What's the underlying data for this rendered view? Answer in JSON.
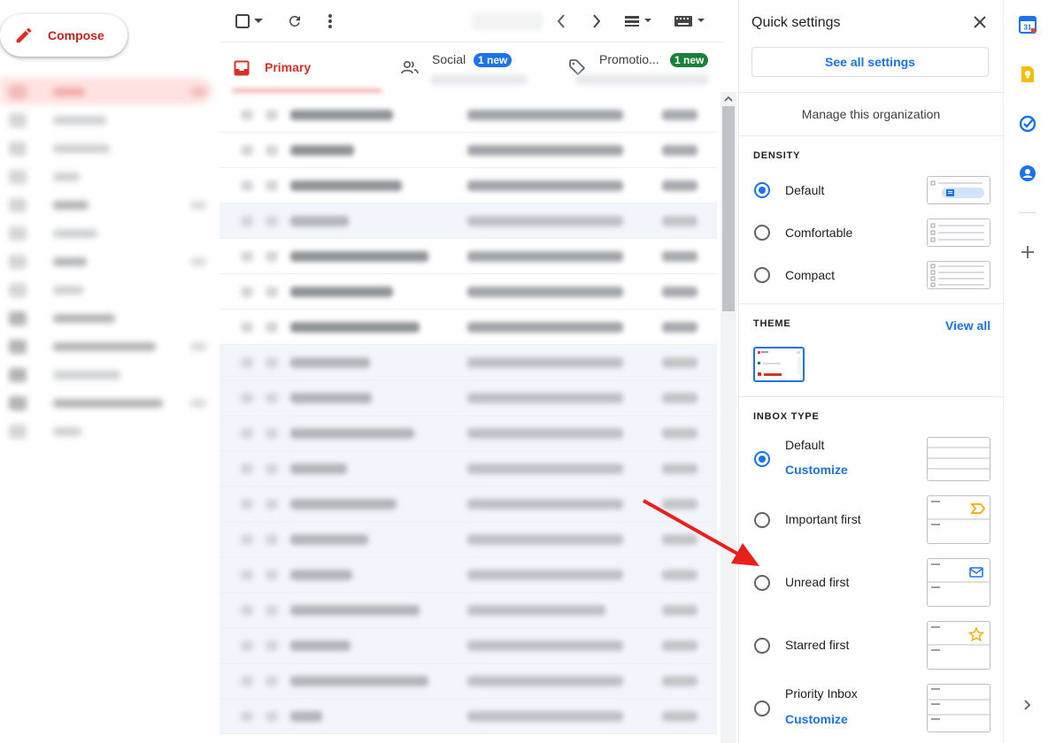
{
  "compose": {
    "label": "Compose"
  },
  "tabs": {
    "primary": "Primary",
    "social": "Social",
    "social_badge": "1 new",
    "promotions": "Promotio...",
    "promotions_badge": "1 new"
  },
  "colors": {
    "brand_red": "#d93025",
    "accent_blue": "#1a73e8",
    "badge_blue": "#1a73e8",
    "badge_green": "#188038",
    "arrow_red": "#e8201c"
  },
  "quick_settings": {
    "title": "Quick settings",
    "see_all": "See all settings",
    "manage": "Manage this organization",
    "density": {
      "title": "DENSITY",
      "options": [
        "Default",
        "Comfortable",
        "Compact"
      ],
      "selected": "Default"
    },
    "theme": {
      "title": "THEME",
      "view_all": "View all"
    },
    "inbox_type": {
      "title": "INBOX TYPE",
      "options": [
        "Default",
        "Important first",
        "Unread first",
        "Starred first",
        "Priority Inbox"
      ],
      "customize": "Customize",
      "selected": "Default"
    }
  },
  "icons": {
    "toolbar": [
      "checkbox-icon",
      "chevron-down-icon",
      "refresh-icon",
      "more-vert-icon",
      "chevron-left-icon",
      "chevron-right-icon",
      "split-pane-icon",
      "keyboard-icon"
    ],
    "rail": [
      "calendar-icon",
      "keep-icon",
      "tasks-icon",
      "contacts-icon",
      "add-icon",
      "expand-icon"
    ]
  }
}
